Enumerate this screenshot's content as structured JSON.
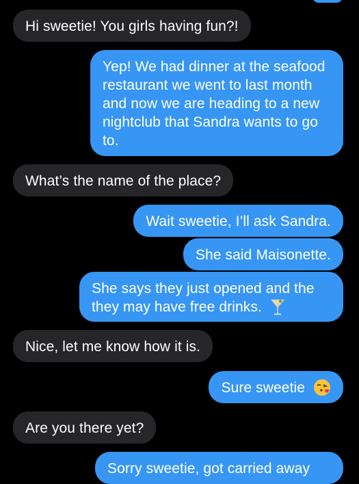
{
  "colors": {
    "background": "#000000",
    "incoming_bubble": "#262628",
    "outgoing_bubble": "#3796f3",
    "text": "#ffffff"
  },
  "messages": [
    {
      "sender": "them",
      "text": "Hi sweetie! You girls having fun?!"
    },
    {
      "sender": "me",
      "text": "Yep! We had dinner at the seafood restaurant we went to last month and now we are heading to a new nightclub that Sandra wants to go to."
    },
    {
      "sender": "them",
      "text": "What’s the name of the place?"
    },
    {
      "sender": "me",
      "text": "Wait sweetie, I’ll ask Sandra."
    },
    {
      "sender": "me",
      "text": "She said Maisonette."
    },
    {
      "sender": "me",
      "text": "She says they just opened and the they may have free drinks.",
      "emoji": "cocktail-glass-icon"
    },
    {
      "sender": "them",
      "text": "Nice, let me know how it is."
    },
    {
      "sender": "me",
      "text": "Sure sweetie",
      "emoji": "face-blowing-kiss-icon"
    },
    {
      "sender": "them",
      "text": "Are you there yet?"
    },
    {
      "sender": "me",
      "text": "Sorry sweetie, got carried away",
      "partially_visible": true
    }
  ]
}
